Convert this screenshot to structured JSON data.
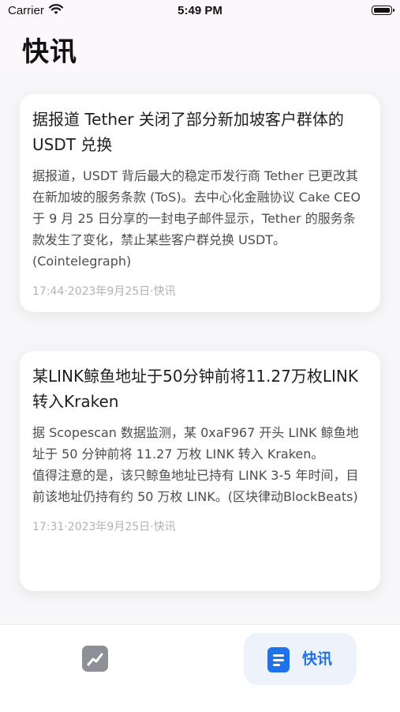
{
  "status_bar": {
    "carrier": "Carrier",
    "time": "5:49 PM"
  },
  "header": {
    "title": "快讯"
  },
  "news": [
    {
      "title": "据报道 Tether 关闭了部分新加坡客户群体的 USDT 兑换",
      "body": "据报道，USDT 背后最大的稳定币发行商 Tether 已更改其在新加坡的服务条款 (ToS)。去中心化金融协议 Cake CEO 于 9 月 25 日分享的一封电子邮件显示，Tether 的服务条款发生了变化，禁止某些客户群兑换 USDT。(Cointelegraph)",
      "meta": "17:44·2023年9月25日·快讯"
    },
    {
      "title": "某LINK鲸鱼地址于50分钟前将11.27万枚LINK转入Kraken",
      "body": "据 Scopescan 数据监测，某 0xaF967 开头 LINK 鲸鱼地址于 50 分钟前将 11.27 万枚 LINK 转入 Kraken。\n值得注意的是，该只鲸鱼地址已持有 LINK 3-5 年时间，目前该地址仍持有约 50 万枚 LINK。(区块律动BlockBeats)",
      "meta": "17:31·2023年9月25日·快讯"
    }
  ],
  "tab_bar": {
    "chart_icon": "chart-trend-icon",
    "news_icon": "news-document-icon",
    "news_label": "快讯",
    "accent_color": "#1f73ea"
  }
}
